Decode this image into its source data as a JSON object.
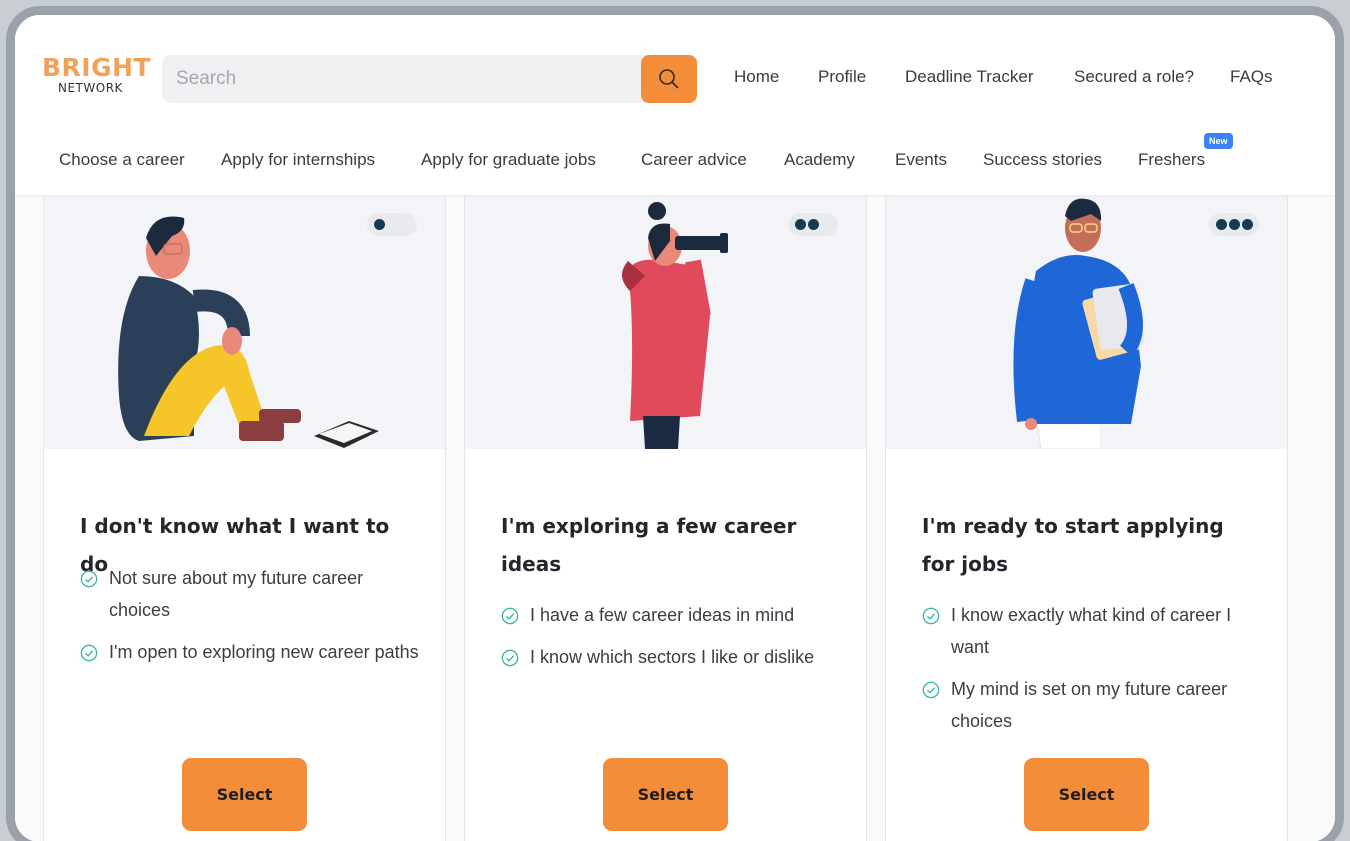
{
  "logo": {
    "line1": "BRIGHT",
    "line2": "NETWORK"
  },
  "search": {
    "placeholder": "Search"
  },
  "top_nav": [
    "Home",
    "Profile",
    "Deadline Tracker",
    "Secured a role?",
    "FAQs"
  ],
  "main_nav": [
    "Choose a career",
    "Apply for internships",
    "Apply for graduate jobs",
    "Career advice",
    "Academy",
    "Events",
    "Success stories",
    "Freshers"
  ],
  "new_badge": "New",
  "colors": {
    "accent": "#f48d3a",
    "check": "#3fb9a0",
    "dot": "#163a52",
    "badge": "#3b82f6"
  },
  "cards": [
    {
      "title": "I don't know what I want to do",
      "progress_dots": 1,
      "bullets": [
        "Not sure about my future career choices",
        "I'm open to exploring new career paths"
      ],
      "button": "Select"
    },
    {
      "title": "I'm exploring a few career ideas",
      "progress_dots": 2,
      "bullets": [
        "I have a few career ideas in mind",
        "I know which sectors I like or dislike"
      ],
      "button": "Select"
    },
    {
      "title": "I'm ready to start applying for jobs",
      "progress_dots": 3,
      "bullets": [
        "I know exactly what kind of career I want",
        "My mind is set on my future career choices"
      ],
      "button": "Select"
    }
  ]
}
